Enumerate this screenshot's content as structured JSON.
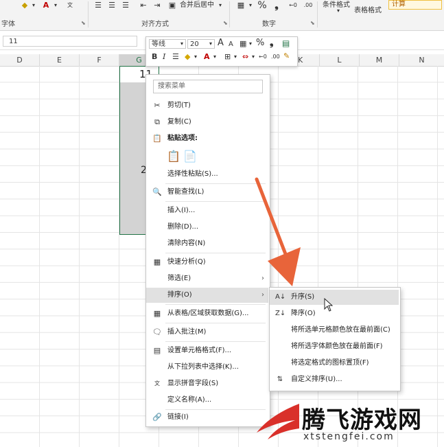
{
  "ribbon": {
    "font_group": "字体",
    "alignment_group": "对齐方式",
    "number_group": "数字",
    "merge_center": "合并后居中",
    "cond_format_1": "条件格式",
    "table_format": "表格格式",
    "calc_style": "计算"
  },
  "formula_bar": {
    "name_box": "11"
  },
  "columns": [
    "D",
    "E",
    "F",
    "G",
    "K",
    "L",
    "M",
    "N"
  ],
  "cells": {
    "g_top": "11",
    "g_second_partial": "2"
  },
  "mini_toolbar": {
    "font_name": "等线",
    "font_size": "20",
    "grow_font": "A",
    "shrink_font": "A",
    "percent": "%",
    "comma": "❟",
    "bold": "B",
    "italic": "I"
  },
  "context_menu": {
    "search_placeholder": "搜索菜单",
    "items": [
      {
        "label": "剪切(T)",
        "icon": "scissors-icon"
      },
      {
        "label": "复制(C)",
        "icon": "copy-icon"
      },
      {
        "label": "粘贴选项:",
        "icon": "paste-icon"
      },
      {
        "label": "选择性粘贴(S)..."
      },
      {
        "label": "智能查找(L)",
        "icon": "smart-lookup-icon"
      },
      {
        "label": "插入(I)..."
      },
      {
        "label": "删除(D)..."
      },
      {
        "label": "清除内容(N)"
      },
      {
        "label": "快速分析(Q)",
        "icon": "quick-analysis-icon"
      },
      {
        "label": "筛选(E)"
      },
      {
        "label": "排序(O)"
      },
      {
        "label": "从表格/区域获取数据(G)...",
        "icon": "table-icon"
      },
      {
        "label": "插入批注(M)",
        "icon": "comment-icon"
      },
      {
        "label": "设置单元格格式(F)...",
        "icon": "format-cells-icon"
      },
      {
        "label": "从下拉列表中选择(K)..."
      },
      {
        "label": "显示拼音字段(S)",
        "icon": "phonetic-icon"
      },
      {
        "label": "定义名称(A)..."
      },
      {
        "label": "链接(I)",
        "icon": "link-icon"
      }
    ]
  },
  "sort_submenu": {
    "items": [
      {
        "label": "升序(S)",
        "icon": "sort-asc-icon"
      },
      {
        "label": "降序(O)",
        "icon": "sort-desc-icon"
      },
      {
        "label": "将所选单元格颜色放在最前面(C)"
      },
      {
        "label": "将所选字体颜色放在最前面(F)"
      },
      {
        "label": "将选定格式的图标置顶(F)"
      },
      {
        "label": "自定义排序(U)...",
        "icon": "custom-sort-icon"
      }
    ]
  },
  "watermark": {
    "brand": "腾飞游戏网",
    "url": "xtstengfei.com"
  },
  "colors": {
    "accent_green": "#217346",
    "arrow_orange": "#e8643a",
    "watermark_red": "#d9302a"
  }
}
